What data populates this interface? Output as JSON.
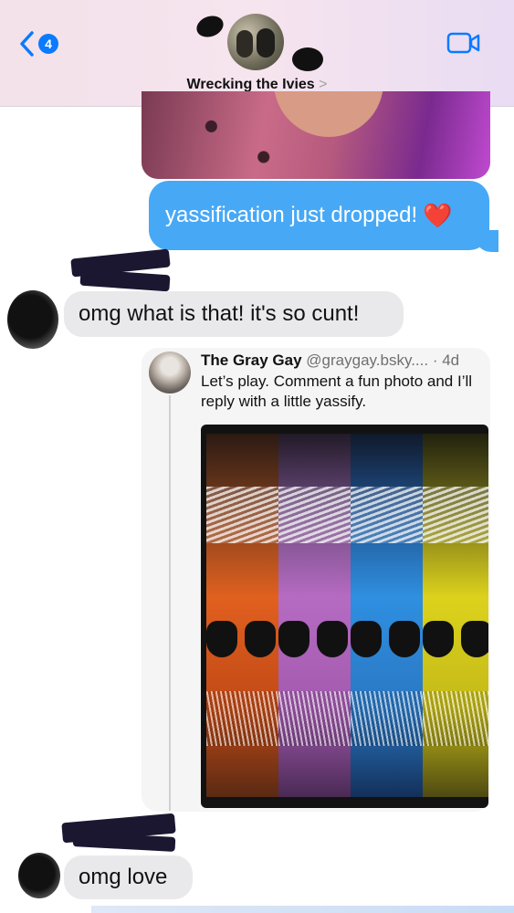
{
  "header": {
    "back_count": "4",
    "group_name": "Wrecking the Ivies",
    "chevron": ">"
  },
  "messages": {
    "sent_text": "yassification just dropped!",
    "sent_emoji": "❤️",
    "received_1": "omg what is that! it's so cunt!",
    "received_2": "omg love"
  },
  "link_card": {
    "author_name": "The Gray Gay",
    "author_handle": "@graygay.bsky....",
    "age": "· 4d",
    "post_text": "Let’s play.  Comment a fun photo and I’ll reply with a little yassify."
  },
  "colors": {
    "sent_bubble": "#47a8f6",
    "received_bubble": "#e9e9eb",
    "accent": "#0a7aff",
    "photo_strips": [
      "#e0601f",
      "#b66bc2",
      "#2f8fe0",
      "#dcd21c"
    ]
  },
  "icons": [
    "back-chevron-icon",
    "video-call-icon",
    "heart-emoji-icon"
  ]
}
